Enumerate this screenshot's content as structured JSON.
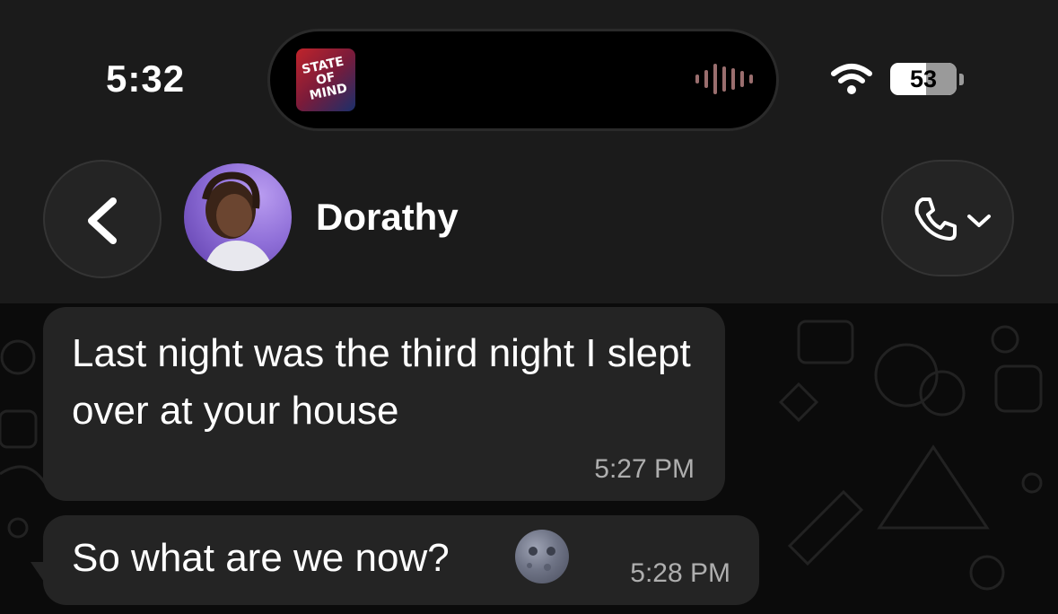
{
  "status_bar": {
    "time": "5:32",
    "album_art_text": "STATE OF MIND",
    "battery": "53"
  },
  "header": {
    "contact_name": "Dorathy"
  },
  "messages": [
    {
      "text": "Last night was the third night I slept over at your house",
      "time": "5:27 PM"
    },
    {
      "text": "So what are we now?",
      "emoji": "new-moon-face",
      "time": "5:28 PM"
    }
  ],
  "colors": {
    "header_bg": "#1b1b1b",
    "chat_bg": "#0b0b0b",
    "bubble_bg": "#242424",
    "timestamp": "#aeaeae"
  },
  "icons": [
    "back-chevron-icon",
    "phone-icon",
    "chevron-down-icon",
    "wifi-icon",
    "battery-icon",
    "waveform-icon",
    "moon-emoji-icon"
  ]
}
